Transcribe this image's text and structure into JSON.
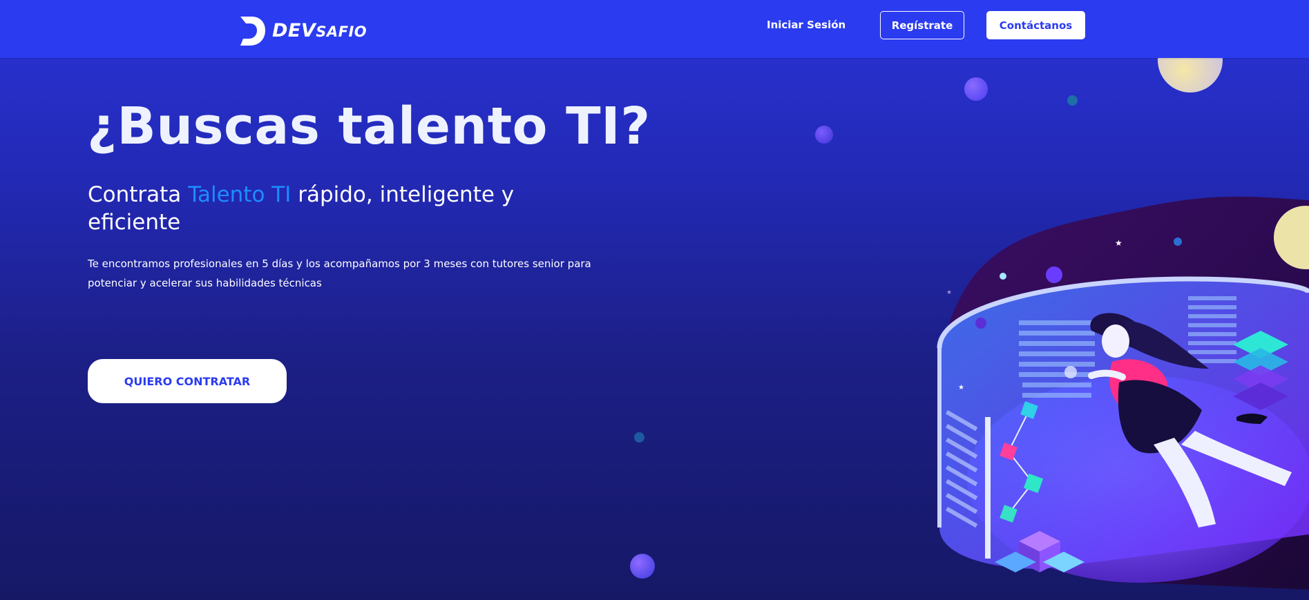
{
  "brand": {
    "name_main": "DEV",
    "name_rest": "SAFIO"
  },
  "nav": {
    "login_label": "Iniciar Sesión",
    "register_label": "Regístrate",
    "contact_label": "Contáctanos"
  },
  "hero": {
    "title": "¿Buscas talento TI?",
    "subtitle_prefix": "Contrata ",
    "subtitle_accent": "Talento TI",
    "subtitle_suffix": " rápido, inteligente y eficiente",
    "description": "Te encontramos profesionales en 5 días y los acompañamos por 3 meses con tutores senior para potenciar y acelerar sus habilidades técnicas",
    "cta_label": "QUIERO CONTRATAR"
  },
  "colors": {
    "topbar": "#2b3bf0",
    "accent": "#1e8cff",
    "background_top": "#2a33d8",
    "background_bottom": "#161866"
  },
  "icons": {
    "logo": "devsafio-logo-icon"
  }
}
